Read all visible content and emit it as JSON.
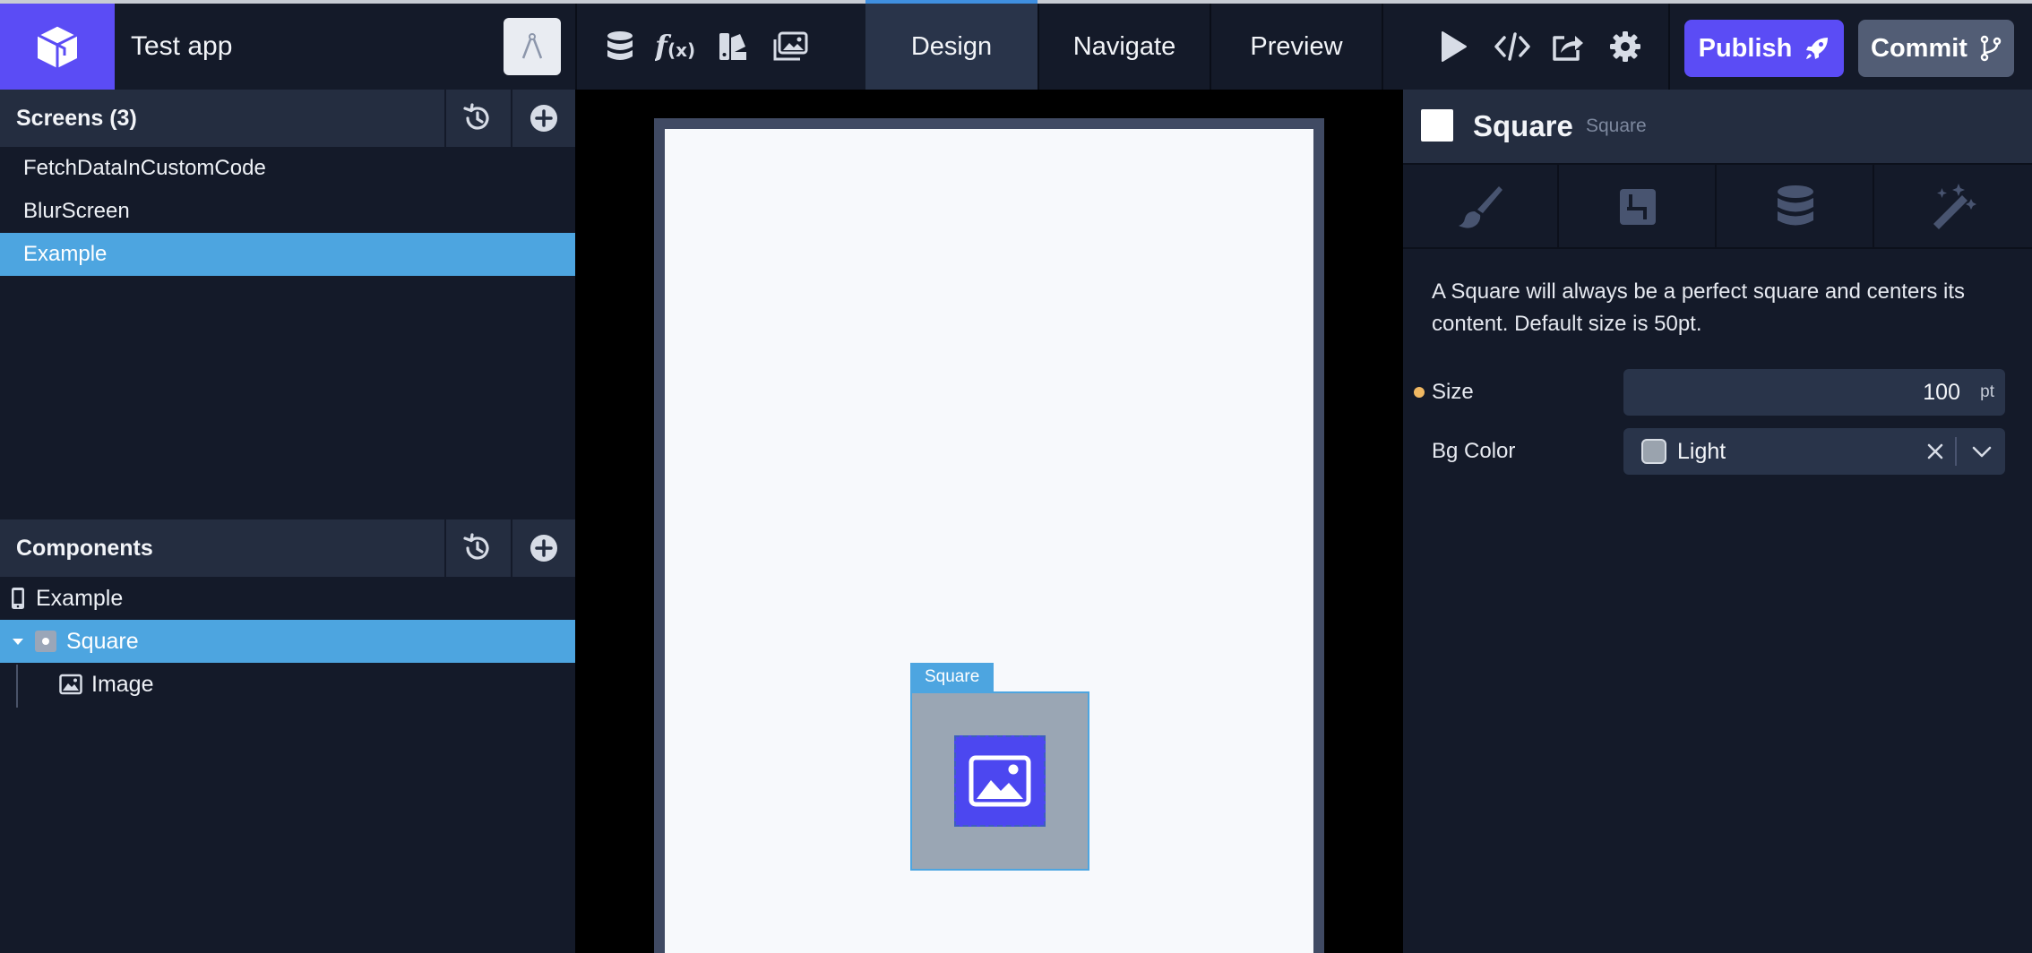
{
  "app": {
    "title": "Test app"
  },
  "nav_tabs": [
    {
      "label": "Design",
      "active": true
    },
    {
      "label": "Navigate",
      "active": false
    },
    {
      "label": "Preview",
      "active": false
    }
  ],
  "toolbar_icons": [
    "database-icon",
    "function-icon",
    "theme-icon",
    "media-icon",
    "play-icon",
    "code-icon",
    "share-icon",
    "gear-icon"
  ],
  "publish": {
    "label": "Publish"
  },
  "commit": {
    "label": "Commit"
  },
  "screens": {
    "title": "Screens (3)",
    "items": [
      {
        "label": "FetchDataInCustomCode",
        "selected": false
      },
      {
        "label": "BlurScreen",
        "selected": false
      },
      {
        "label": "Example",
        "selected": true
      }
    ]
  },
  "components": {
    "title": "Components",
    "items": [
      {
        "label": "Example",
        "icon": "phone-icon",
        "selected": false
      },
      {
        "label": "Square",
        "icon": "square-component-icon",
        "selected": true,
        "expanded": true
      },
      {
        "label": "Image",
        "icon": "image-icon",
        "selected": false
      }
    ]
  },
  "canvas": {
    "selection_label": "Square"
  },
  "inspector": {
    "title": "Square",
    "subtitle": "Square",
    "tabs": [
      "brush-icon",
      "layout-icon",
      "database-icon",
      "magic-wand-icon"
    ],
    "description": "A Square will always be a perfect square and centers its content. Default size is 50pt.",
    "size": {
      "label": "Size",
      "value": "100",
      "unit": "pt",
      "modified": true
    },
    "bg_color": {
      "label": "Bg Color",
      "value": "Light",
      "swatch": "#9aa3ae"
    }
  },
  "colors": {
    "accent": "#5b4cf5",
    "selection": "#4da5e0",
    "panel": "#141a29",
    "header": "#242d40"
  }
}
